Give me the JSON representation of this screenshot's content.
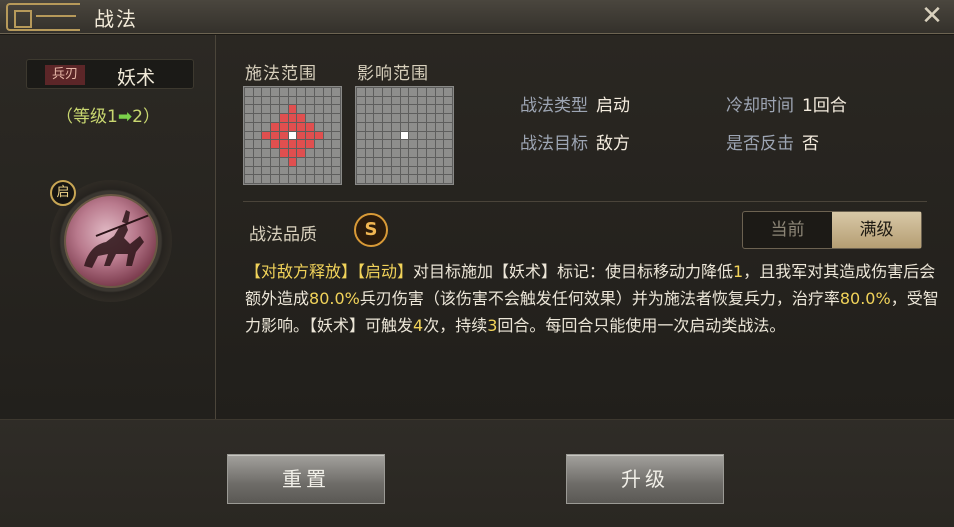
{
  "window": {
    "title": "战法",
    "close_icon": "close-icon"
  },
  "skill": {
    "type_tag": "兵刃",
    "name": "妖术",
    "level_prefix": "（等级1",
    "level_arrow": "➡",
    "level_suffix": "2）",
    "portrait_badge": "启"
  },
  "ranges": {
    "cast_label": "施法范围",
    "effect_label": "影响范围"
  },
  "info": {
    "type_key": "战法类型",
    "type_val": "启动",
    "cooldown_key": "冷却时间",
    "cooldown_val": "1回合",
    "target_key": "战法目标",
    "target_val": "敌方",
    "counter_key": "是否反击",
    "counter_val": "否"
  },
  "quality": {
    "label": "战法品质",
    "grade": "S"
  },
  "toggle": {
    "current": "当前",
    "max": "满级",
    "selected": "满级"
  },
  "description": {
    "p1": "【对敌方释放】",
    "p2": "【启动】",
    "p3": "对目标施加【妖术】标记：使目标移动力降低",
    "p4": "1",
    "p5": "，且我军对其造成伤害后会额外造成",
    "p6": "80.0%",
    "p7": "兵刃伤害（该伤害不会触发任何效果）并为施法者恢复兵力，治疗率",
    "p8": "80.0%",
    "p9": "，受智力影响。【妖术】可触发",
    "p10": "4",
    "p11": "次，持续",
    "p12": "3",
    "p13": "回合。每回合只能使用一次启动类战法。"
  },
  "buttons": {
    "reset": "重置",
    "upgrade": "升级"
  }
}
